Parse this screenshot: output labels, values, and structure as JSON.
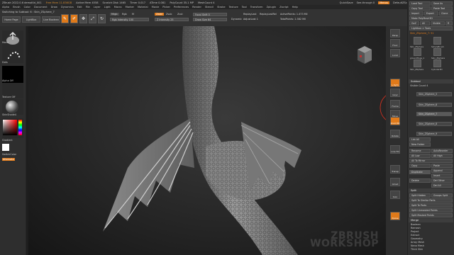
{
  "titlebar": {
    "app": "ZBrush 2022.0.6 demoKid_001",
    "free_mem": "Free Mem 11.836GB",
    "active_mem": "Active Mem 4558",
    "scratch": "Scratch Disk 1465",
    "timer": "Timer 0.017",
    "atime": "ATime 0.081",
    "polycount": "PolyCount 35.1 MP",
    "meshcount": "MeshCount 4",
    "quicksave": "QuickSave",
    "seethrough": "See-through 0",
    "menus": "Menus",
    "default_script": "DefaultZScript"
  },
  "menubar": {
    "items": [
      "Alpha",
      "Brush",
      "Color",
      "Document",
      "Draw",
      "Dynamics",
      "Edit",
      "File",
      "Layer",
      "Light",
      "Macro",
      "Marker",
      "Material",
      "Movie",
      "Picker",
      "Preferences",
      "Render",
      "Stencil",
      "Stroke",
      "Texture",
      "Tool",
      "Transform",
      "Zplugin",
      "Zscript",
      "Help"
    ],
    "switching": "Switching to Subtool: 6 : Skin_ZSphere_7"
  },
  "shelf": {
    "tabs": [
      "Home Page",
      "LightBox",
      "Live Boolean"
    ],
    "icon_buttons": [
      "Edit",
      "Draw",
      "Move",
      "Scale",
      "Rotate"
    ],
    "mrgb": "Mrgb",
    "rgb": "Rgb",
    "m": "M",
    "rgb_intensity": "Rgb Intensity 100",
    "zadd": "Zadd",
    "zsub": "Zsub",
    "zcut": "Zcut",
    "z_intensity": "Z Intensity 25",
    "focal_shift": "Focal Shift 0",
    "draw_size": "Draw Size 64",
    "dynamic": "Dynamic",
    "replayLast": "ReplayLast",
    "replayLastRel": "ReplayLastRel",
    "active_points": "ActivePoints: 1.473 Mil",
    "total_points": "TotalPoints: 2.382 Mil",
    "adjust_last": "AdjustLast 1"
  },
  "lefttray": {
    "labels": [
      "Move",
      "Dots",
      "Alpha Off",
      "Texture Off",
      "SkinShade4",
      "Gradient",
      "SwitchColor",
      "Alternate"
    ]
  },
  "righttray": {
    "top_buttons": [
      "Load Tool",
      "Save As",
      "Copy Tool",
      "Paste Tool",
      "Import",
      "Export",
      "Clone",
      "Make PolyMesh3D",
      "GoZ",
      "All",
      "Visible",
      "R",
      "Lightbox > Tools"
    ],
    "tool_name": "Skin_ZSphere_7: 51",
    "thumb_labels": [
      "Skin_ZSphere",
      "SimpleBrush",
      "groundHogs_1",
      "Skin_ZSphere",
      "Skin_ZSphere",
      "Cylinder3D",
      "PolyMesh3D",
      "Sphere3D",
      "Skin_ZSphere",
      "PolyMesh3D"
    ],
    "subtool_header": "Subtool",
    "visible_count": "Visible Count 4",
    "subtools": [
      "Skin_ZSphere_5",
      "Skin_ZSphere_6",
      "Skin_ZSphere_7",
      "Skin_ZSphere_8",
      "Skin_ZSphere_9"
    ],
    "list_all": "List All",
    "new_folder": "New Folder",
    "ops": [
      "Rename",
      "AutoReorder",
      "All Low",
      "All High",
      "Copy",
      "Paste",
      "Append",
      "Duplicate",
      "Insert",
      "Del Other",
      "Delete",
      "Del All"
    ],
    "all_to_mesh": "All To Mirror",
    "split_header": "Split",
    "split": [
      "Split Hidden",
      "Groups Split",
      "Split To Similar Parts",
      "Split To Parts",
      "Split Unmasked Points",
      "Split Masked Points"
    ],
    "merge_header": "Merge",
    "extra": [
      "Boolean",
      "Remesh",
      "Project",
      "Extract",
      "Geometry",
      "Array Mesh",
      "Nano Mesh",
      "Thick Skin",
      "Layers",
      "Fibermesh"
    ]
  },
  "rightshelf": {
    "buttons": [
      "Persp",
      "Floor",
      "Local",
      "L.Sym",
      "Gxyz",
      "Frame",
      "Move",
      "Zoom3D",
      "Rotate",
      "Line Fill",
      "Transp",
      "Ghost",
      "Solo",
      "Xpose"
    ]
  },
  "watermark": {
    "line1": "ZBRUSH",
    "line2": "WORKSHOP"
  },
  "colors": {
    "accent": "#e07a1a",
    "panel": "#303030",
    "viewport_center": "#3a3a3a"
  }
}
